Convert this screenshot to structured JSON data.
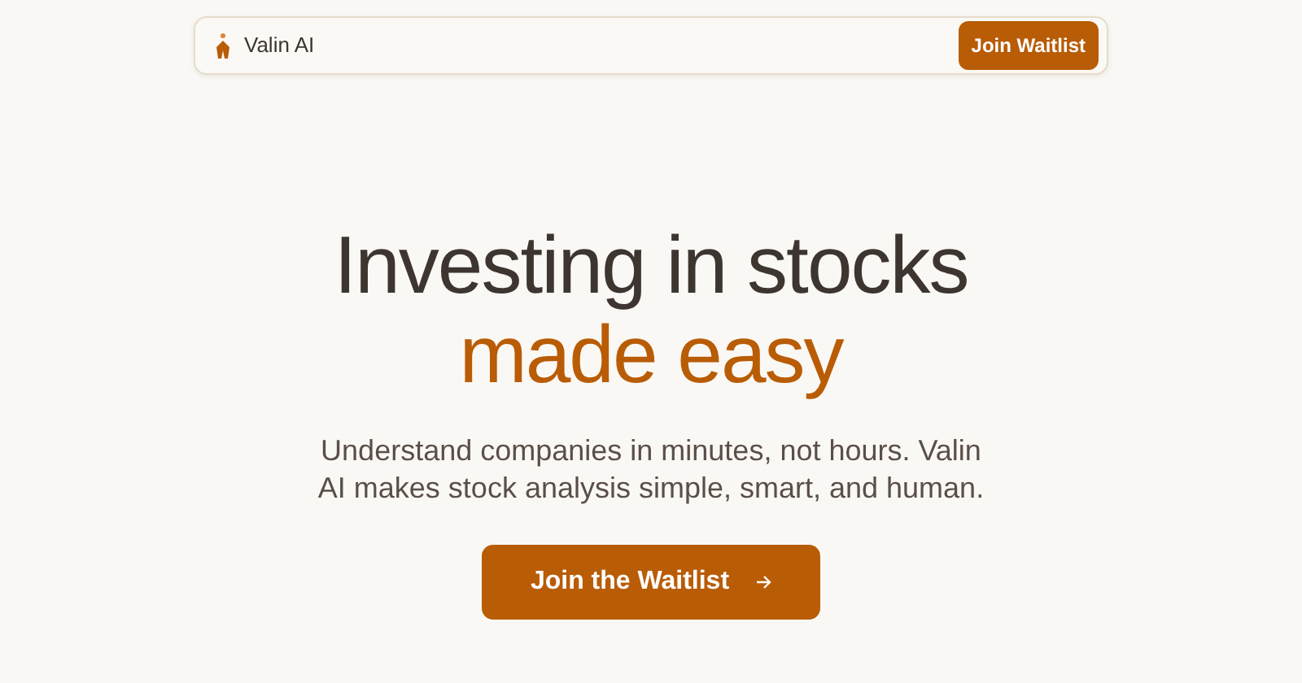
{
  "navbar": {
    "brand": "Valin AI",
    "button": "Join Waitlist"
  },
  "hero": {
    "title_line_1": "Investing in stocks",
    "title_line_2": "made easy",
    "subtitle": "Understand companies in minutes, not hours. Valin AI makes stock analysis simple, smart, and human.",
    "button": "Join the Waitlist"
  }
}
